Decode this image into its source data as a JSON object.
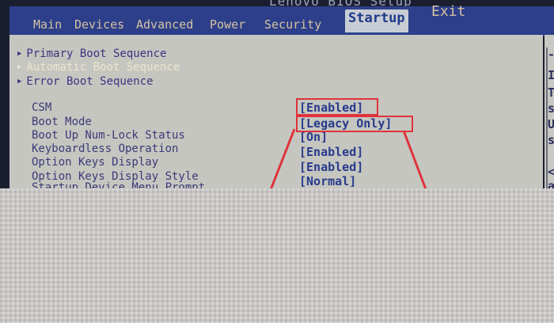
{
  "header": {
    "bios_title": "Lenovo BIOS Setup"
  },
  "tabs": [
    {
      "label": "Main"
    },
    {
      "label": "Devices"
    },
    {
      "label": "Advanced"
    },
    {
      "label": "Power"
    },
    {
      "label": "Security"
    },
    {
      "label": "Startup",
      "active": true
    },
    {
      "label": "Exit"
    }
  ],
  "menu_items": [
    {
      "label": "Primary Boot Sequence"
    },
    {
      "label": "Automatic Boot Sequence",
      "selected": true
    },
    {
      "label": "Error Boot Sequence"
    }
  ],
  "settings": [
    {
      "label": "CSM",
      "value": "[Enabled]",
      "highlighted": true
    },
    {
      "label": "Boot Mode",
      "value": "[Legacy Only]",
      "highlighted": true
    },
    {
      "label": "Boot Up Num-Lock Status",
      "value": "[On]"
    },
    {
      "label": "Keyboardless Operation",
      "value": "[Enabled]"
    },
    {
      "label": "Option Keys Display",
      "value": "[Enabled]"
    },
    {
      "label": "Option Keys Display Style",
      "value": "[Normal]"
    },
    {
      "label": "Startup Device Menu Prompt",
      "value": ""
    }
  ],
  "help_panel": {
    "glyphs": [
      "-",
      "I",
      "T",
      "s",
      "U",
      "s",
      "<",
      "a"
    ]
  },
  "colors": {
    "menubar": "#2d3f8a",
    "panel": "#c5c6c0",
    "item_text": "#3c3480",
    "selected_text": "#ece4cf",
    "value_text": "#283a8c",
    "annotation_red": "#e0333b"
  }
}
